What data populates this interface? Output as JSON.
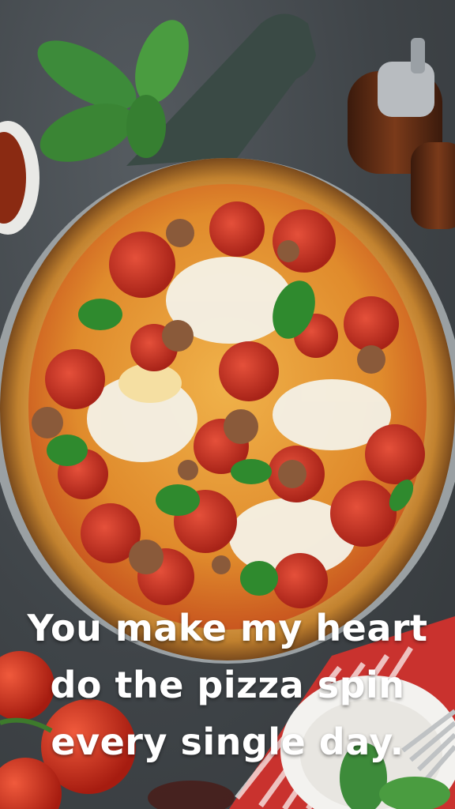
{
  "caption": {
    "line1": "You make my heart",
    "line2": "do the pizza spin",
    "line3": "every single day."
  },
  "colors": {
    "background": "#3f4448",
    "crust": "#c98a3c",
    "sauce": "#d9822a",
    "pepperoni": "#c0392b",
    "mozzarella": "#f4f1e6",
    "basil": "#3d8b3a",
    "board": "#3a4a45",
    "tomato": "#d3301f",
    "caption_text": "#ffffff"
  }
}
